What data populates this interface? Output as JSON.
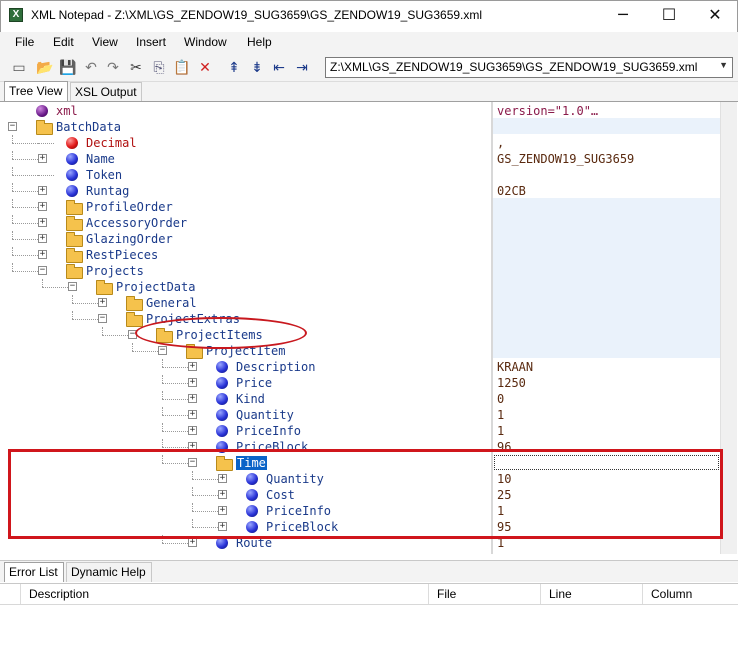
{
  "window": {
    "app_icon_letter": "X",
    "title": "XML Notepad - Z:\\XML\\GS_ZENDOW19_SUG3659\\GS_ZENDOW19_SUG3659.xml",
    "minimize_glyph": "─",
    "maximize_glyph": "☐",
    "close_glyph": "✕"
  },
  "menu": [
    "File",
    "Edit",
    "View",
    "Insert",
    "Window",
    "Help"
  ],
  "toolbar": {
    "icons": [
      "new-file-icon",
      "open-folder-icon",
      "save-icon",
      "undo-icon",
      "redo-icon",
      "cut-icon",
      "copy-icon",
      "paste-icon",
      "delete-icon",
      "nudge-up-icon",
      "nudge-down-icon",
      "nudge-left-icon",
      "nudge-right-icon"
    ],
    "path": "Z:\\XML\\GS_ZENDOW19_SUG3659\\GS_ZENDOW19_SUG3659.xml"
  },
  "tabs": [
    "Tree View",
    "XSL Output"
  ],
  "tree": [
    {
      "label": "xml",
      "icon": "purple-ball",
      "value": "version=\"1.0\"…",
      "expander": ""
    },
    {
      "label": "BatchData",
      "icon": "folder",
      "value": "",
      "expander": "−"
    },
    {
      "label": "Decimal",
      "icon": "red-ball",
      "value": ",",
      "expander": ""
    },
    {
      "label": "Name",
      "icon": "blue-ball",
      "value": "GS_ZENDOW19_SUG3659",
      "expander": "+"
    },
    {
      "label": "Token",
      "icon": "blue-ball",
      "value": "",
      "expander": ""
    },
    {
      "label": "Runtag",
      "icon": "blue-ball",
      "value": "02CB",
      "expander": "+"
    },
    {
      "label": "ProfileOrder",
      "icon": "folder",
      "value": "",
      "expander": "+"
    },
    {
      "label": "AccessoryOrder",
      "icon": "folder",
      "value": "",
      "expander": "+"
    },
    {
      "label": "GlazingOrder",
      "icon": "folder",
      "value": "",
      "expander": "+"
    },
    {
      "label": "RestPieces",
      "icon": "folder",
      "value": "",
      "expander": "+"
    },
    {
      "label": "Projects",
      "icon": "folder",
      "value": "",
      "expander": "−"
    },
    {
      "label": "ProjectData",
      "icon": "folder",
      "value": "",
      "expander": "−"
    },
    {
      "label": "General",
      "icon": "folder",
      "value": "",
      "expander": "+"
    },
    {
      "label": "ProjectExtras",
      "icon": "folder",
      "value": "",
      "expander": "−"
    },
    {
      "label": "ProjectItems",
      "icon": "folder",
      "value": "",
      "expander": "−"
    },
    {
      "label": "ProjectItem",
      "icon": "folder",
      "value": "",
      "expander": "−"
    },
    {
      "label": "Description",
      "icon": "blue-ball",
      "value": "KRAAN",
      "expander": "+"
    },
    {
      "label": "Price",
      "icon": "blue-ball",
      "value": "1250",
      "expander": "+"
    },
    {
      "label": "Kind",
      "icon": "blue-ball",
      "value": "0",
      "expander": "+"
    },
    {
      "label": "Quantity",
      "icon": "blue-ball",
      "value": "1",
      "expander": "+"
    },
    {
      "label": "PriceInfo",
      "icon": "blue-ball",
      "value": "1",
      "expander": "+"
    },
    {
      "label": "PriceBlock",
      "icon": "blue-ball",
      "value": "96",
      "expander": "+"
    },
    {
      "label": "Time",
      "icon": "folder",
      "value": "",
      "expander": "−"
    },
    {
      "label": "Quantity",
      "icon": "blue-ball",
      "value": "10",
      "expander": "+"
    },
    {
      "label": "Cost",
      "icon": "blue-ball",
      "value": "25",
      "expander": "+"
    },
    {
      "label": "PriceInfo",
      "icon": "blue-ball",
      "value": "1",
      "expander": "+"
    },
    {
      "label": "PriceBlock",
      "icon": "blue-ball",
      "value": "95",
      "expander": "+"
    },
    {
      "label": "Route",
      "icon": "blue-ball",
      "value": "1",
      "expander": "+"
    }
  ],
  "bottom": {
    "tabs": [
      "Error List",
      "Dynamic Help"
    ],
    "columns": [
      "Description",
      "File",
      "Line",
      "Column"
    ]
  },
  "colors": {
    "annotation": "#d0161c",
    "selection": "#0a64c8",
    "value_band": "#eaf2fb"
  }
}
